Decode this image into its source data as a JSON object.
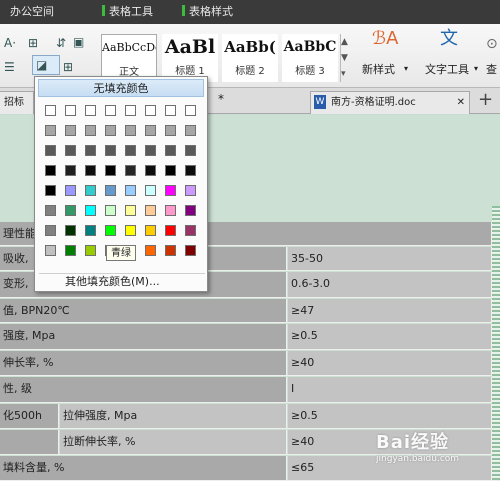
{
  "top_tabs": [
    {
      "label": "办公空间",
      "marked": false
    },
    {
      "label": "表格工具",
      "marked": true
    },
    {
      "label": "表格样式",
      "marked": true
    }
  ],
  "ribbon": {
    "styles": [
      {
        "sample": "AaBbCcDd",
        "caption": "正文"
      },
      {
        "sample": "AaBl",
        "caption": "标题 1"
      },
      {
        "sample": "AaBb(",
        "caption": "标题 2"
      },
      {
        "sample": "AaBbC",
        "caption": "标题 3"
      }
    ],
    "new_style_label": "新样式",
    "text_tool_label": "文字工具",
    "find_label": "查"
  },
  "doc_tabs": {
    "left": "招标文",
    "current": "南方-资格证明.doc",
    "asterisk": "*",
    "add": "+"
  },
  "color_popup": {
    "no_fill": "无填充颜色",
    "more": "其他填充颜色(M)...",
    "tooltip": "青绿",
    "colors": [
      [
        "#ffffff",
        "#ffffff",
        "#ffffff",
        "#ffffff",
        "#ffffff",
        "#ffffff",
        "#ffffff",
        "#ffffff"
      ],
      [
        "#a6a6a6",
        "#a6a6a6",
        "#a6a6a6",
        "#a6a6a6",
        "#a6a6a6",
        "#a6a6a6",
        "#a6a6a6",
        "#a6a6a6"
      ],
      [
        "#595959",
        "#595959",
        "#595959",
        "#595959",
        "#595959",
        "#595959",
        "#595959",
        "#595959"
      ],
      [
        "#000000",
        "#1f1f1f",
        "#0d0d0d",
        "#000000",
        "#262626",
        "#0d0d0d",
        "#000000",
        "#0d0d0d"
      ],
      [
        "#000000",
        "#9999ff",
        "#33cccc",
        "#6699cc",
        "#99ccff",
        "#ccffff",
        "#ff00ff",
        "#cc99ff"
      ],
      [
        "#808080",
        "#339966",
        "#00ffff",
        "#ccffcc",
        "#ffff99",
        "#ffcc99",
        "#ff99cc",
        "#800080"
      ],
      [
        "#808080",
        "#003300",
        "#008080",
        "#00ff00",
        "#ffff00",
        "#ffcc00",
        "#ff0000",
        "#993366"
      ],
      [
        "#c0c0c0",
        "#008000",
        "#99cc00",
        "#003366",
        "#ff9900",
        "#ff6600",
        "#cc3300",
        "#800000"
      ]
    ]
  },
  "table_rows": [
    [
      {
        "text": "理性能"
      }
    ],
    [
      {
        "text": "吸收,"
      },
      {
        "text": "35-50"
      }
    ],
    [
      {
        "text": "变形,"
      },
      {
        "text": "0.6-3.0"
      }
    ],
    [
      {
        "text": "值, BPN20℃"
      },
      {
        "text": "≥47"
      }
    ],
    [
      {
        "text": "强度, Mpa"
      },
      {
        "text": "≥0.5"
      }
    ],
    [
      {
        "text": "伸长率, %"
      },
      {
        "text": "≥40"
      }
    ],
    [
      {
        "text": "性, 级"
      },
      {
        "text": "I"
      }
    ],
    [
      {
        "text": "化500h"
      },
      {
        "text": "拉伸强度, Mpa"
      },
      {
        "text": "≥0.5"
      }
    ],
    [
      {
        "text": ""
      },
      {
        "text": "拉断伸长率, %"
      },
      {
        "text": "≥40"
      }
    ],
    [
      {
        "text": "填料含量, %"
      },
      {
        "text": "≤65"
      }
    ]
  ],
  "watermark": {
    "text": "Bai经验",
    "sub": "jingyan.baidu.com"
  }
}
